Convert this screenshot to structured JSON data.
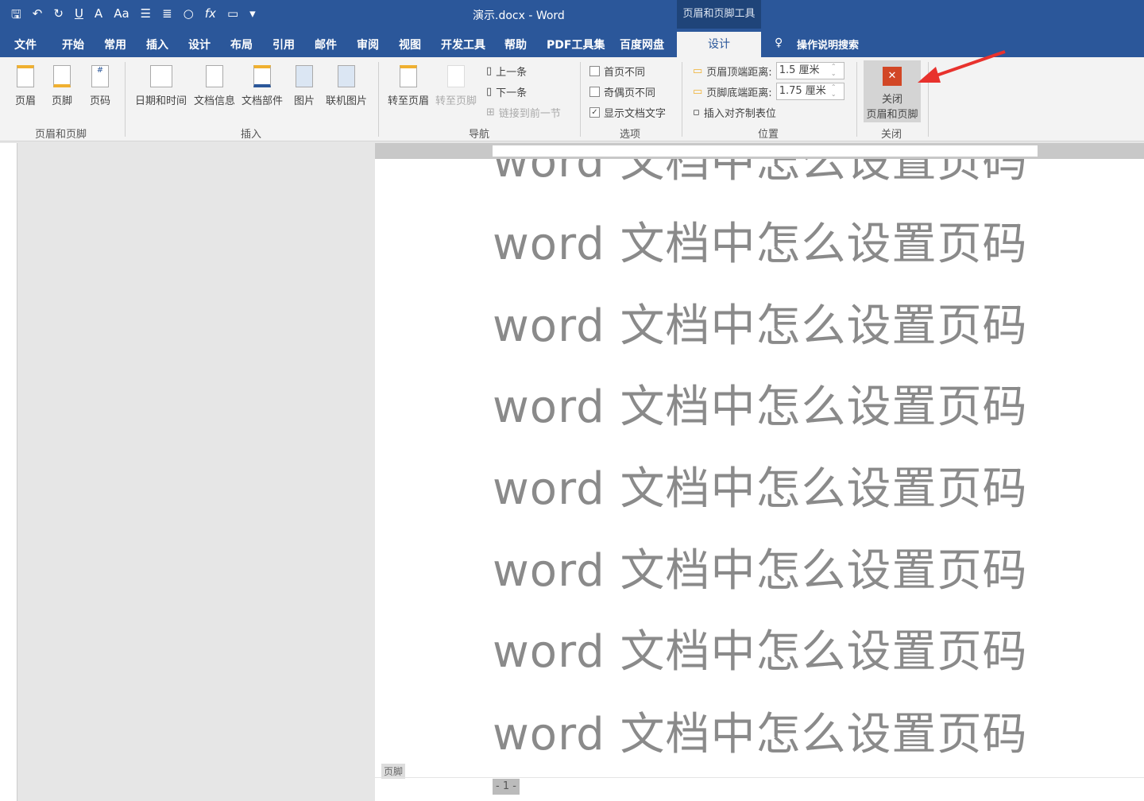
{
  "window": {
    "title": "演示.docx  -  Word",
    "context_tool": "页眉和页脚工具"
  },
  "qat": [
    "save-icon",
    "undo-icon",
    "redo-icon",
    "underline-icon",
    "font-color-icon",
    "font-size-icon",
    "list-icon",
    "align-icon",
    "shape-icon",
    "formula-icon",
    "comment-icon",
    "customize-icon"
  ],
  "tabs": [
    "文件",
    "开始",
    "常用",
    "插入",
    "设计",
    "布局",
    "引用",
    "邮件",
    "审阅",
    "视图",
    "开发工具",
    "帮助",
    "PDF工具集",
    "百度网盘",
    "设计"
  ],
  "search": "操作说明搜索",
  "ribbon": {
    "hf": {
      "header": "页眉",
      "footer": "页脚",
      "pagenum": "页码",
      "group": "页眉和页脚"
    },
    "insert": {
      "datetime": "日期和时间",
      "docinfo": "文档信息",
      "parts": "文档部件",
      "picture": "图片",
      "online": "联机图片",
      "group": "插入"
    },
    "nav": {
      "gotoheader": "转至页眉",
      "gotofooter": "转至页脚",
      "prev": "上一条",
      "next": "下一条",
      "link": "链接到前一节",
      "group": "导航"
    },
    "options": {
      "first": "首页不同",
      "oddeven": "奇偶页不同",
      "showtext": "显示文档文字",
      "group": "选项",
      "first_checked": false,
      "oddeven_checked": false,
      "showtext_checked": true
    },
    "position": {
      "top_label": "页眉顶端距离:",
      "top_value": "1.5 厘米",
      "bottom_label": "页脚底端距离:",
      "bottom_value": "1.75 厘米",
      "tab": "插入对齐制表位",
      "group": "位置"
    },
    "close": {
      "line1": "关闭",
      "line2": "页眉和页脚",
      "group": "关闭"
    }
  },
  "document": {
    "lines": [
      "word 文档中怎么设置页码",
      "word 文档中怎么设置页码",
      "word 文档中怎么设置页码",
      "word 文档中怎么设置页码",
      "word 文档中怎么设置页码",
      "word 文档中怎么设置页码",
      "word 文档中怎么设置页码",
      "word 文档中怎么设置页码"
    ],
    "footer_label": "页脚",
    "page_number": "- 1 -"
  },
  "colors": {
    "accent": "#2b579a",
    "close": "#d24726",
    "arrow": "#e8322d"
  }
}
